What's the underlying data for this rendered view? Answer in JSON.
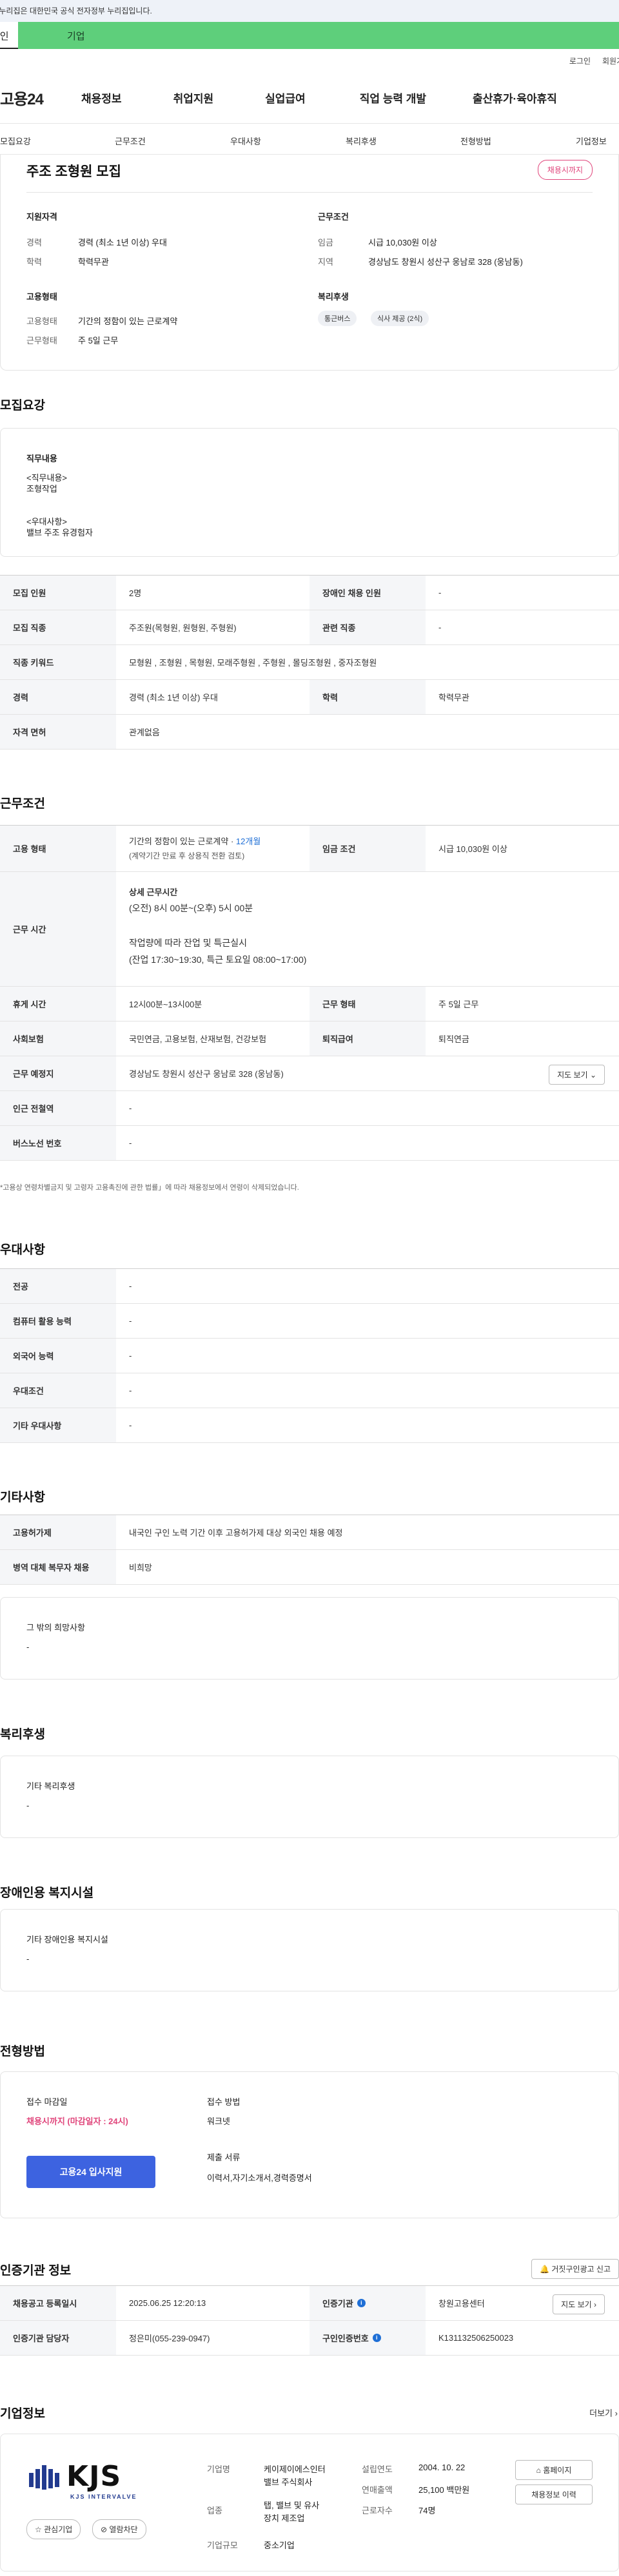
{
  "gov_banner": "이 누리집은 대한민국 공식 전자정부 누리집입니다.",
  "top_tabs": {
    "individual": "개인",
    "company": "기업"
  },
  "util": {
    "login": "로그인",
    "signup": "회원가입"
  },
  "header": {
    "logo": "고용24",
    "gnb": [
      "채용정보",
      "취업지원",
      "실업급여",
      "직업 능력 개발",
      "출산휴가·육아휴직"
    ]
  },
  "anchor_nav": [
    "모집요강",
    "근무조건",
    "우대사항",
    "복리후생",
    "전형방법",
    "기업정보"
  ],
  "summary": {
    "title": "주조 조형원 모집",
    "status": "채용시까지",
    "applicant_heading": "지원자격",
    "career_label": "경력",
    "career_value": "경력 (최소 1년 이상) 우대",
    "edu_label": "학력",
    "edu_value": "학력무관",
    "work_heading": "근무조건",
    "wage_label": "임금",
    "wage_value": "시급 10,030원 이상",
    "region_label": "지역",
    "region_value": "경상남도 창원시 성산구 웅남로 328 (웅남동)",
    "employ_heading": "고용형태",
    "emp_type_label": "고용형태",
    "emp_type_value": "기간의 정함이 있는 근로계약",
    "work_form_label": "근무형태",
    "work_form_value": "주 5일 근무",
    "welfare_heading": "복리후생",
    "welfare_chips": [
      "통근버스",
      "식사 제공 (2식)"
    ]
  },
  "recruit": {
    "title": "모집요강",
    "duty_heading": "직무내용",
    "duty_text": [
      "<직무내용>",
      "조형작업",
      "",
      "<우대사항>",
      "밸브 주조 유경험자"
    ],
    "rows": [
      {
        "k1": "모집 인원",
        "v1": "2명",
        "k2": "장애인 채용 인원",
        "v2": "-"
      },
      {
        "k1": "모집 직종",
        "v1": "주조원(목형원, 원형원, 주형원)",
        "k2": "관련 직종",
        "v2": "-"
      },
      {
        "k1": "직종 키워드",
        "v1": "모형원 , 조형원 , 목형원, 모래주형원 , 주형원 , 몰딩조형원 , 중자조형원"
      },
      {
        "k1": "경력",
        "v1": "경력 (최소 1년 이상) 우대",
        "k2": "학력",
        "v2": "학력무관"
      },
      {
        "k1": "자격 면허",
        "v1": "관계없음"
      }
    ]
  },
  "conditions": {
    "title": "근무조건",
    "emp_type_label": "고용 형태",
    "emp_type_line1_prefix": "기간의 정함이 있는 근로계약 · ",
    "emp_type_line1_months": "12개월",
    "emp_type_line2": "(계약기간 만료 후 상용직 전환 검토)",
    "wage_label": "임금 조건",
    "wage_value": "시급 10,030원 이상",
    "hours_label": "근무 시간",
    "hours_lines": [
      "상세 근무시간",
      "(오전) 8시 00분~(오후) 5시 00분",
      "",
      "작업량에 따라 잔업 및 특근실시",
      "(잔업 17:30~19:30, 특근 토요일 08:00~17:00)"
    ],
    "break_label": "휴게 시간",
    "break_value": "12시00분~13시00분",
    "form_label": "근무 형태",
    "form_value": "주 5일 근무",
    "insurance_label": "사회보험",
    "insurance_value": "국민연금, 고용보험, 산재보험, 건강보험",
    "retire_label": "퇴직급여",
    "retire_value": "퇴직연금",
    "place_label": "근무 예정지",
    "place_value": "경상남도 창원시 성산구 웅남로 328 (웅남동)",
    "map_button": "지도 보기",
    "subway_label": "인근 전철역",
    "subway_value": "-",
    "bus_label": "버스노선 번호",
    "bus_value": "-",
    "note": "*고용상 연령차별금지 및 고령자 고용촉진에 관한 법률」에 따라 채용정보에서 연령이 삭제되었습니다."
  },
  "preference": {
    "title": "우대사항",
    "rows": [
      {
        "k": "전공",
        "v": "-"
      },
      {
        "k": "컴퓨터 활용 능력",
        "v": "-"
      },
      {
        "k": "외국어 능력",
        "v": "-"
      },
      {
        "k": "우대조건",
        "v": "-"
      },
      {
        "k": "기타 우대사항",
        "v": "-"
      }
    ]
  },
  "etc": {
    "title": "기타사항",
    "rows": [
      {
        "k": "고용허가제",
        "v": "내국인 구인 노력 기간 이후 고용허가제 대상 외국인 채용 예정"
      },
      {
        "k": "병역 대체 복무자 채용",
        "v": "비희망"
      }
    ],
    "other_heading": "그 밖의 희망사항",
    "other_value": "-"
  },
  "welfare": {
    "title": "복리후생",
    "heading": "기타 복리후생",
    "value": "-"
  },
  "disability": {
    "title": "장애인용 복지시설",
    "heading": "기타 장애인용 복지시설",
    "value": "-"
  },
  "selection": {
    "title": "전형방법",
    "deadline_heading": "접수 마감일",
    "deadline_value": "채용시까지 (마감일자 : 24시)",
    "apply_button": "고용24 입사지원",
    "method_heading": "접수 방법",
    "method_value": "워크넷",
    "docs_heading": "제출 서류",
    "docs_value": "이력서,자기소개서,경력증명서"
  },
  "agency": {
    "title": "인증기관 정보",
    "report_button": "거짓구인광고 신고",
    "reg_date_label": "채용공고 등록일시",
    "reg_date_value": "2025.06.25 12:20:13",
    "agency_label": "인증기관",
    "agency_value": "창원고용센터",
    "map_button": "지도 보기",
    "manager_label": "인증기관 담당자",
    "manager_value": "정은미(055-239-0947)",
    "auth_no_label": "구인인증번호",
    "auth_no_value": "K131132506250023"
  },
  "company": {
    "title": "기업정보",
    "more": "더보기",
    "logo_text": "KJS",
    "logo_sub": "KJS INTERVALVE",
    "interest_button": "관심기업",
    "block_button": "열람차단",
    "name_label": "기업명",
    "name_value": [
      "케이제이에스인터",
      "밸브 주식회사"
    ],
    "industry_label": "업종",
    "industry_value": [
      "탭, 밸브 및 유사",
      "장치 제조업"
    ],
    "size_label": "기업규모",
    "size_value": "중소기업",
    "founded_label": "설립연도",
    "founded_value": "2004. 10. 22",
    "sales_label": "연매출액",
    "sales_value": "25,100 백만원",
    "staff_label": "근로자수",
    "staff_value": "74명",
    "homepage_button": "홈페이지",
    "history_button": "채용정보 이력"
  },
  "colors": {
    "brand_green": "#5ecf7b",
    "accent_blue": "#3d63e0",
    "status_pink": "#e0457b"
  }
}
